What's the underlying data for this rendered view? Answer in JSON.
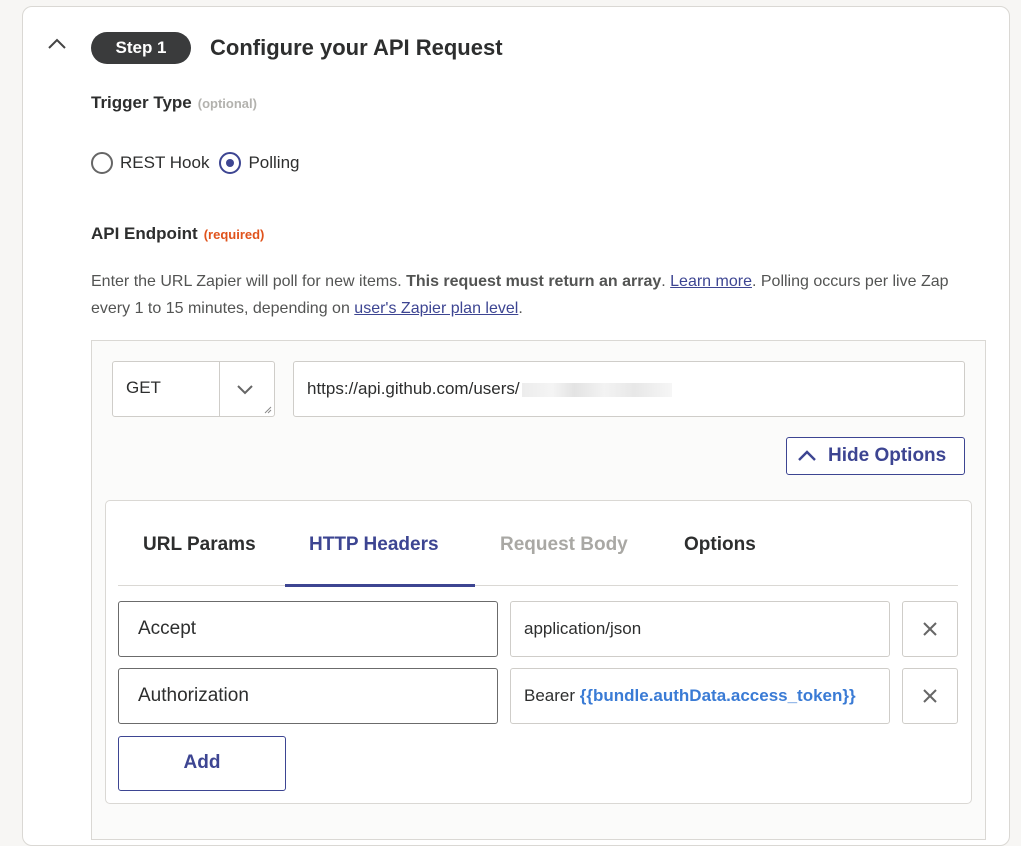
{
  "step": {
    "badge": "Step 1",
    "title": "Configure your API Request"
  },
  "trigger_type": {
    "label": "Trigger Type",
    "tag": "(optional)",
    "options": [
      {
        "label": "REST Hook",
        "checked": false
      },
      {
        "label": "Polling",
        "checked": true
      }
    ]
  },
  "endpoint": {
    "label": "API Endpoint",
    "tag": "(required)",
    "help": {
      "text1": "Enter the URL Zapier will poll for new items. ",
      "bold": "This request must return an array",
      "text2": ". ",
      "link1": "Learn more",
      "text3": ". Polling occurs per live Zap every 1 to 15 minutes, depending on ",
      "link2": "user's Zapier plan level",
      "text4": "."
    },
    "method": "GET",
    "url": "https://api.github.com/users/"
  },
  "hide_options_label": "Hide Options",
  "tabs": [
    {
      "label": "URL Params",
      "state": "normal"
    },
    {
      "label": "HTTP Headers",
      "state": "active"
    },
    {
      "label": "Request Body",
      "state": "disabled"
    },
    {
      "label": "Options",
      "state": "normal"
    }
  ],
  "headers": [
    {
      "key": "Accept",
      "value": "application/json",
      "value_token": ""
    },
    {
      "key": "Authorization",
      "value": "Bearer ",
      "value_token": "{{bundle.authData.access_token}}"
    }
  ],
  "add_label": "Add",
  "colors": {
    "accent": "#3d4592",
    "required": "#e0531c",
    "token": "#3a7bd5"
  },
  "icons": {
    "collapse": "chevron-up-icon",
    "method": "chevron-down-icon",
    "delete": "close-icon"
  }
}
